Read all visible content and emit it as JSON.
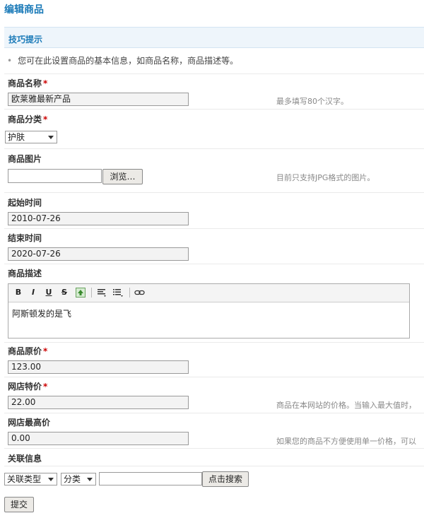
{
  "page": {
    "title": "编辑商品"
  },
  "tips": {
    "title": "技巧提示",
    "text": "您可在此设置商品的基本信息，如商品名称，商品描述等。"
  },
  "form": {
    "name": {
      "label": "商品名称",
      "required": "*",
      "value": "欧莱雅最新产品",
      "hint": "最多填写80个汉字。"
    },
    "category": {
      "label": "商品分类",
      "required": "*",
      "selected": "护肤"
    },
    "image": {
      "label": "商品图片",
      "browse_label": "浏览…",
      "hint": "目前只支持JPG格式的图片。"
    },
    "start_time": {
      "label": "起始时间",
      "value": "2010-07-26"
    },
    "end_time": {
      "label": "结束时间",
      "value": "2020-07-26"
    },
    "description": {
      "label": "商品描述",
      "content": "阿斯顿发的是飞",
      "toolbar": {
        "bold": "B",
        "italic": "I",
        "underline": "U",
        "strike": "S"
      }
    },
    "original_price": {
      "label": "商品原价",
      "required": "*",
      "value": "123.00"
    },
    "shop_price": {
      "label": "网店特价",
      "required": "*",
      "value": "22.00",
      "hint": "商品在本网站的价格。当输入最大值时，"
    },
    "max_price": {
      "label": "网店最高价",
      "value": "0.00",
      "hint": "如果您的商品不方便使用单一价格，可以"
    },
    "related": {
      "label": "关联信息",
      "type_selected": "关联类型",
      "category_selected": "分类",
      "search_label": "点击搜索"
    },
    "submit_label": "提交"
  },
  "colors": {
    "title": "#1a7ab8",
    "tip_bg": "#eef5fb",
    "required": "#cc0000"
  }
}
